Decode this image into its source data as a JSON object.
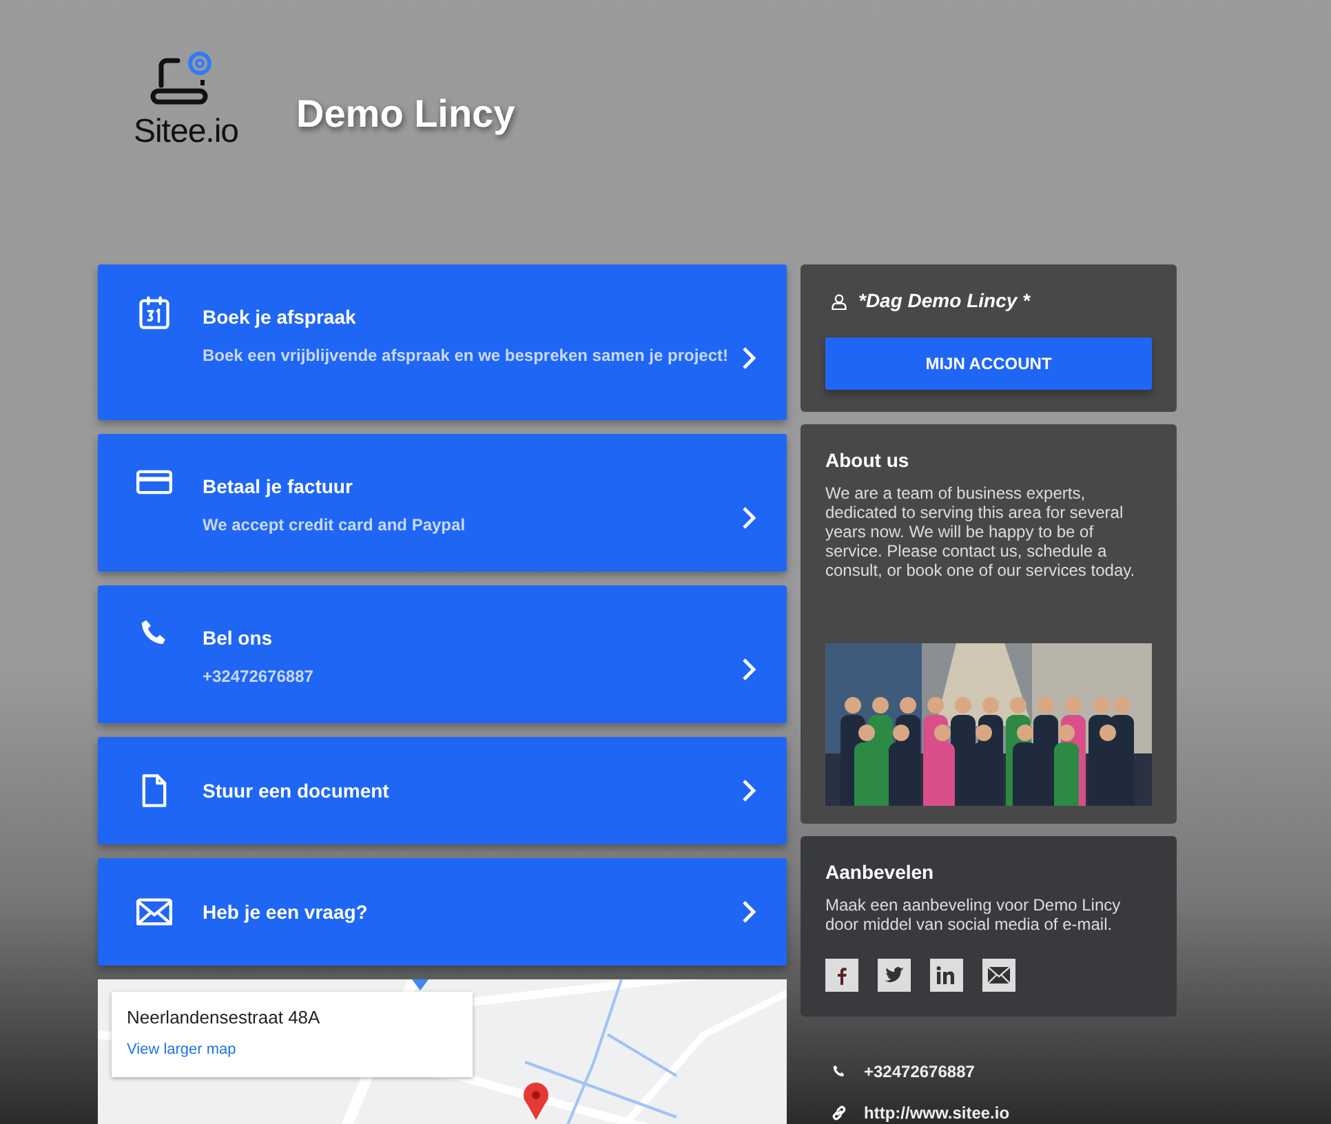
{
  "header": {
    "logo_text": "Sitee.io",
    "title": "Demo Lincy"
  },
  "actions": [
    {
      "kind": "calendar",
      "title": "Boek je afspraak",
      "subtitle": "Boek een vrijblijvende afspraak en we bespreken samen je project!"
    },
    {
      "kind": "card",
      "title": "Betaal je factuur",
      "subtitle": "We accept credit card and Paypal"
    },
    {
      "kind": "phone",
      "title": "Bel ons",
      "subtitle": "+32472676887"
    },
    {
      "kind": "document",
      "title": "Stuur een document"
    },
    {
      "kind": "mail",
      "title": "Heb je een vraag?"
    }
  ],
  "map": {
    "kind": "picture",
    "address": "Neerlandensestraat 48A",
    "link": "View larger map"
  },
  "account": {
    "greeting": "*Dag Demo Lincy *",
    "button": "MIJN ACCOUNT"
  },
  "about": {
    "title": "About us",
    "text": "We are a team of business experts, dedicated to serving this area for several years now. We will be happy to be of service. Please contact us, schedule a consult, or book one of our services today."
  },
  "recommend": {
    "title": "Aanbevelen",
    "text": "Maak een aanbeveling voor Demo Lincy door middel van social media of e-mail.",
    "shares": [
      {
        "kind": "facebook"
      },
      {
        "kind": "twitter"
      },
      {
        "kind": "linkedin"
      },
      {
        "kind": "mail"
      }
    ]
  },
  "contact": [
    {
      "kind": "phone",
      "text": "+32472676887"
    },
    {
      "kind": "link",
      "text": "http://www.sitee.io"
    }
  ]
}
